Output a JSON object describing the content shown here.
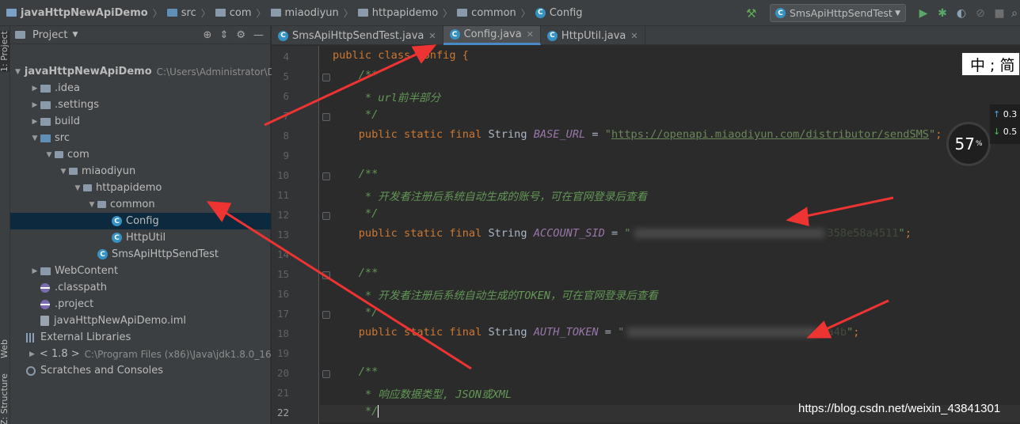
{
  "breadcrumbs": [
    "javaHttpNewApiDemo",
    "src",
    "com",
    "miaodiyun",
    "httpapidemo",
    "common",
    "Config"
  ],
  "run_config": "SmsApiHttpSendTest",
  "project_panel": {
    "title": "Project",
    "tree": [
      {
        "label": "javaHttpNewApiDemo",
        "hint": "C:\\Users\\Administrator\\D",
        "level": 0,
        "arrow": "▼",
        "icon": "project",
        "bold": true
      },
      {
        "label": ".idea",
        "level": 1,
        "arrow": "▶",
        "icon": "folder"
      },
      {
        "label": ".settings",
        "level": 1,
        "arrow": "▶",
        "icon": "folder"
      },
      {
        "label": "build",
        "level": 1,
        "arrow": "▶",
        "icon": "folder"
      },
      {
        "label": "src",
        "level": 1,
        "arrow": "▼",
        "icon": "folder-blue"
      },
      {
        "label": "com",
        "level": 2,
        "arrow": "▼",
        "icon": "package"
      },
      {
        "label": "miaodiyun",
        "level": 3,
        "arrow": "▼",
        "icon": "package"
      },
      {
        "label": "httpapidemo",
        "level": 4,
        "arrow": "▼",
        "icon": "package"
      },
      {
        "label": "common",
        "level": 5,
        "arrow": "▼",
        "icon": "package"
      },
      {
        "label": "Config",
        "level": 6,
        "arrow": "",
        "icon": "class",
        "selected": true
      },
      {
        "label": "HttpUtil",
        "level": 6,
        "arrow": "",
        "icon": "class"
      },
      {
        "label": "SmsApiHttpSendTest",
        "level": 5,
        "arrow": "",
        "icon": "class"
      },
      {
        "label": "WebContent",
        "level": 1,
        "arrow": "▶",
        "icon": "folder"
      },
      {
        "label": ".classpath",
        "level": 1,
        "arrow": "",
        "icon": "eclipse"
      },
      {
        "label": ".project",
        "level": 1,
        "arrow": "",
        "icon": "eclipse"
      },
      {
        "label": "javaHttpNewApiDemo.iml",
        "level": 1,
        "arrow": "",
        "icon": "iml"
      },
      {
        "label": "External Libraries",
        "level": 0,
        "arrow": "",
        "icon": "library"
      },
      {
        "label": "< 1.8 >",
        "hint": "C:\\Program Files (x86)\\Java\\jdk1.8.0_16",
        "level": 1,
        "arrow": "▶",
        "icon": "jdk"
      },
      {
        "label": "Scratches and Consoles",
        "level": 0,
        "arrow": "",
        "icon": "scratch"
      }
    ]
  },
  "side_tools": [
    "1: Project",
    "Web",
    "Z: Structure"
  ],
  "tabs": [
    {
      "label": "SmsApiHttpSendTest.java",
      "active": false
    },
    {
      "label": "Config.java",
      "active": true
    },
    {
      "label": "HttpUtil.java",
      "active": false
    }
  ],
  "line_numbers": [
    "4",
    "5",
    "6",
    "7",
    "8",
    "9",
    "10",
    "11",
    "12",
    "13",
    "14",
    "15",
    "16",
    "17",
    "18",
    "19",
    "20",
    "21",
    "22"
  ],
  "code": {
    "l4": "public class Config {",
    "l5": "/**",
    "l6": " * url前半部分",
    "l7": " */",
    "l8_kw": "public static final",
    "l8_type": "String",
    "l8_name": "BASE_URL",
    "l8_url": "https://openapi.miaodiyun.com/distributor/sendSMS",
    "l10": "/**",
    "l11": " * 开发者注册后系统自动生成的账号，可在官网登录后查看",
    "l12": " */",
    "l13_name": "ACCOUNT_SID",
    "l13_tail": "358e58a4511",
    "l15": "/**",
    "l16": " * 开发者注册后系统自动生成的TOKEN，可在官网登录后查看",
    "l17": " */",
    "l18_name": "AUTH_TOKEN",
    "l18_tail": "0a4b",
    "l20": "/**",
    "l21": " * 响应数据类型, JSON或XML",
    "l22": " */"
  },
  "ime_indicator": "中 ; 简",
  "monitor": {
    "percent": "57",
    "unit": "%",
    "up": "0.3",
    "down": "0.5"
  },
  "watermark": "https://blog.csdn.net/weixin_43841301",
  "annotation_color": "#ee3333"
}
